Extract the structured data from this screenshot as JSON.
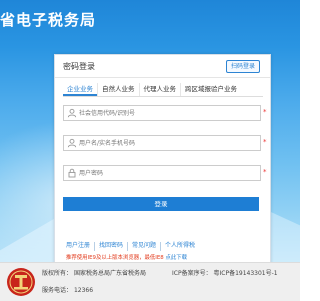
{
  "header": {
    "title": "省电子税务局"
  },
  "login": {
    "title": "密码登录",
    "qr_button": "扫码登录",
    "tabs": [
      "企业业务",
      "自然人业务",
      "代理人业务",
      "跨区域报验户业务"
    ],
    "active_tab": 0,
    "fields": {
      "credit_code_placeholder": "社会信用代码/识别号",
      "username_placeholder": "用户名/实名手机号码",
      "password_placeholder": "用户密码"
    },
    "required_mark": "*",
    "submit_label": "登录"
  },
  "links": [
    "用户注册",
    "找回密码",
    "常见问题",
    "个人所得税"
  ],
  "notice": {
    "red_part": "推荐使用IE9及以上版本浏览器，最低IE8",
    "blue_part": "点此下载"
  },
  "footer": {
    "copyright_label": "版权所有：",
    "copyright_value": "国家税务总局广东省税务局",
    "icp_label": "ICP备案序号：",
    "icp_value": "粤ICP备19143301号-1",
    "phone_label": "服务电话：",
    "phone_value": "12366"
  },
  "colors": {
    "brand_blue": "#1e7ed4",
    "link_blue": "#2d84d3",
    "notice_red": "#e23c1e",
    "required_red": "#ee3333",
    "emblem_red": "#c8251b"
  },
  "icons": {
    "credit_code": "id-card-icon",
    "username": "user-icon",
    "password": "lock-icon",
    "emblem": "tax-emblem-icon"
  }
}
